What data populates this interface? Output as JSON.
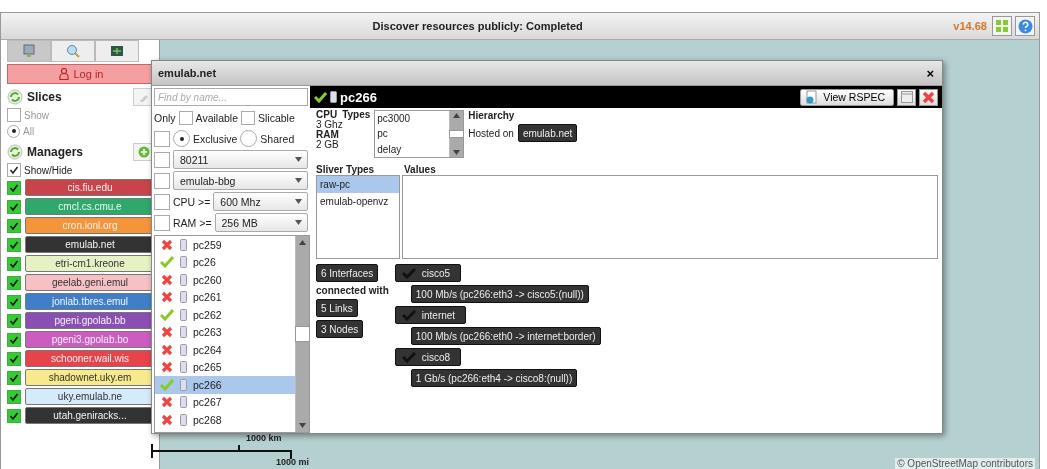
{
  "top_bar": {
    "title": "Discover resources publicly: Completed",
    "version": "v14.68"
  },
  "sidebar": {
    "tabs": [
      {
        "kind": "monitor",
        "selected": true
      },
      {
        "kind": "search",
        "selected": false
      },
      {
        "kind": "grid",
        "selected": false
      }
    ],
    "login": "Log in",
    "slices": {
      "title": "Slices",
      "show": {
        "label": "Show",
        "checked": false
      },
      "all": {
        "label": "All",
        "selected": true
      }
    },
    "managers": {
      "title": "Managers",
      "show_hide": {
        "label": "Show/Hide",
        "checked": true
      },
      "items": [
        {
          "name": "cis.fiu.edu",
          "color": "#c9434a",
          "checked": true
        },
        {
          "name": "cmcl.cs.cmu.e",
          "color": "#2fa86b",
          "checked": true
        },
        {
          "name": "cron.ionl.org",
          "color": "#f5953a",
          "checked": true
        },
        {
          "name": "emulab.net",
          "color": "#333333",
          "checked": true
        },
        {
          "name": "etri-cm1.kreone",
          "color": "#e6f2c4",
          "checked": true
        },
        {
          "name": "geelab.geni.emul",
          "color": "#f6c1c4",
          "checked": true
        },
        {
          "name": "jonlab.tbres.emul",
          "color": "#3f7fc9",
          "checked": true
        },
        {
          "name": "pgeni.gpolab.bb",
          "color": "#8a4fb3",
          "checked": true
        },
        {
          "name": "pgeni3.gpolab.bo",
          "color": "#cc5cc0",
          "checked": true
        },
        {
          "name": "schooner.wail.wis",
          "color": "#e6434a",
          "checked": true
        },
        {
          "name": "shadownet.uky.em",
          "color": "#f7ea8c",
          "checked": true
        },
        {
          "name": "uky.emulab.ne",
          "color": "#d6ebfa",
          "checked": true
        },
        {
          "name": "utah.geniracks...",
          "color": "#333333",
          "checked": true
        }
      ]
    }
  },
  "dialog": {
    "title": "emulab.net",
    "close": "×",
    "filters": {
      "search_placeholder": "Find by name...",
      "only": "Only",
      "available": {
        "label": "Available",
        "checked": false
      },
      "slicable": {
        "label": "Slicable",
        "checked": false
      },
      "exclusive_enabled": {
        "checked": false
      },
      "modes": [
        {
          "label": "Exclusive",
          "selected": true
        },
        {
          "label": "Shared",
          "selected": false
        }
      ],
      "dropdowns": [
        {
          "checked": false,
          "value": "80211"
        },
        {
          "checked": false,
          "value": "emulab-bbg"
        },
        {
          "checked": false,
          "label": "CPU >=",
          "value": "600 Mhz"
        },
        {
          "checked": false,
          "label": "RAM >=",
          "value": "256 MB"
        }
      ]
    },
    "nodes": [
      {
        "name": "pc259",
        "available": false,
        "selected": false
      },
      {
        "name": "pc26",
        "available": true,
        "selected": false
      },
      {
        "name": "pc260",
        "available": false,
        "selected": false
      },
      {
        "name": "pc261",
        "available": false,
        "selected": false
      },
      {
        "name": "pc262",
        "available": true,
        "selected": false
      },
      {
        "name": "pc263",
        "available": false,
        "selected": false
      },
      {
        "name": "pc264",
        "available": false,
        "selected": false
      },
      {
        "name": "pc265",
        "available": false,
        "selected": false
      },
      {
        "name": "pc266",
        "available": true,
        "selected": true
      },
      {
        "name": "pc267",
        "available": false,
        "selected": false
      },
      {
        "name": "pc268",
        "available": false,
        "selected": false
      }
    ],
    "detail": {
      "name": "pc266",
      "available": true,
      "view_rspec": "View RSPEC",
      "cpu_label": "CPU",
      "cpu": "3 Ghz",
      "ram_label": "RAM",
      "ram": "2 GB",
      "types_label": "Types",
      "types": [
        "pc3000",
        "pc",
        "delay"
      ],
      "hierarchy_label": "Hierarchy",
      "hosted_on": "Hosted on",
      "host": "emulab.net",
      "sliver_types_label": "Sliver Types",
      "values_label": "Values",
      "sliver_types": [
        {
          "name": "raw-pc",
          "selected": true
        },
        {
          "name": "emulab-openvz",
          "selected": false
        }
      ],
      "interfaces": "6 Interfaces",
      "connected_with": "connected with",
      "links": "5 Links",
      "nodes": "3 Nodes",
      "connections": [
        {
          "node": "cisco5",
          "link": "100 Mb/s (pc266:eth3 -> cisco5:(null))"
        },
        {
          "node": "internet",
          "link": "100 Mb/s (pc266:eth0 -> internet:border)"
        },
        {
          "node": "cisco8",
          "link": "1 Gb/s (pc266:eth4 -> cisco8:(null))"
        }
      ]
    }
  },
  "map": {
    "scale_km": "1000 km",
    "scale_mi": "1000 mi",
    "attribution": "© OpenStreetMap contributors"
  }
}
